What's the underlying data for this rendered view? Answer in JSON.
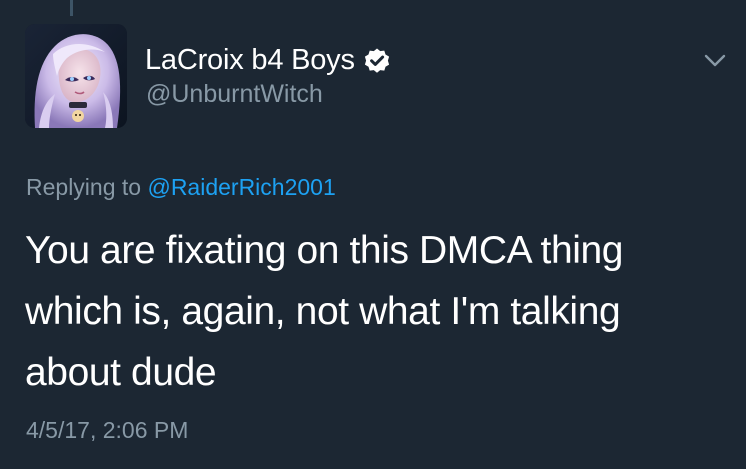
{
  "tweet": {
    "display_name": "LaCroix b4 Boys",
    "handle": "@UnburntWitch",
    "verified_icon": "verified-badge-icon",
    "menu_icon": "chevron-down-icon",
    "replying_to_prefix": "Replying to",
    "replying_to_mention": "@RaiderRich2001",
    "text": "You are fixating on this DMCA thing which is, again, not what I'm talking about dude",
    "timestamp": "4/5/17, 2:06 PM"
  },
  "colors": {
    "background": "#1c2733",
    "primary_text": "#ffffff",
    "secondary_text": "#8899a6",
    "link": "#1da1f2"
  }
}
